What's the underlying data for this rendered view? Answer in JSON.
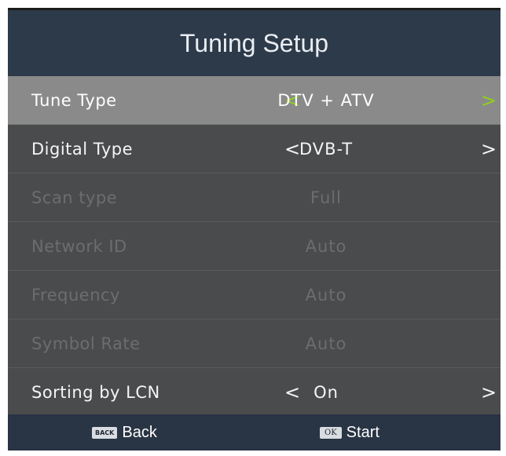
{
  "header": {
    "title": "Tuning Setup"
  },
  "rows": [
    {
      "label": "Tune Type",
      "value": "DTV + ATV",
      "left_arrow": "<",
      "right_arrow": ">"
    },
    {
      "label": "Digital Type",
      "value": "DVB-T",
      "left_arrow": "<",
      "right_arrow": ">"
    },
    {
      "label": "Scan type",
      "value": "Full"
    },
    {
      "label": "Network ID",
      "value": "Auto"
    },
    {
      "label": "Frequency",
      "value": "Auto"
    },
    {
      "label": "Symbol Rate",
      "value": "Auto"
    },
    {
      "label": "Sorting by LCN",
      "value": "On",
      "left_arrow": "<",
      "right_arrow": ">"
    }
  ],
  "footer": {
    "back": {
      "key": "BACK",
      "label": "Back"
    },
    "start": {
      "key": "OK",
      "label": "Start"
    }
  },
  "colors": {
    "header_bg": "#2d3a4a",
    "panel_bg": "#4a4b4d",
    "selected_row_bg": "#8a8a8a",
    "selected_arrow": "#8ed21c",
    "disabled_text": "#6c6d70",
    "footer_bg": "#293444"
  },
  "icons": {
    "left": "chevron-left-icon",
    "right": "chevron-right-icon"
  }
}
